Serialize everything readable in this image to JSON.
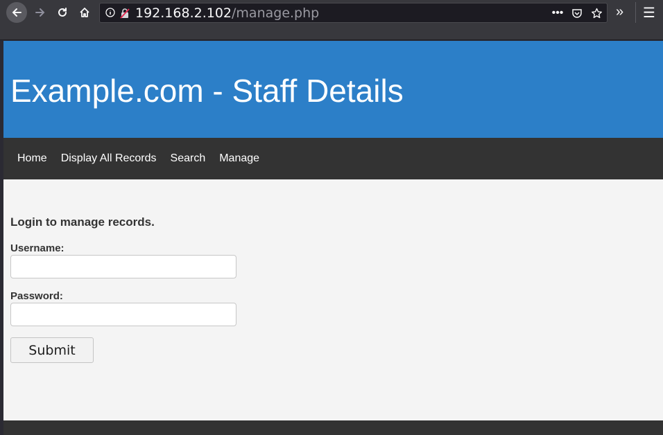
{
  "browser": {
    "url_host": "192.168.2.102",
    "url_path": "/manage.php"
  },
  "page": {
    "site_title": "Example.com - Staff Details",
    "nav": [
      {
        "label": "Home"
      },
      {
        "label": "Display All Records"
      },
      {
        "label": "Search"
      },
      {
        "label": "Manage"
      }
    ],
    "login": {
      "heading": "Login to manage records.",
      "username_label": "Username:",
      "username_value": "",
      "password_label": "Password:",
      "password_value": "",
      "submit_label": "Submit"
    }
  },
  "colors": {
    "header_bg": "#2c7fc8",
    "navbar_bg": "#333333",
    "page_bg": "#f4f4f4"
  }
}
